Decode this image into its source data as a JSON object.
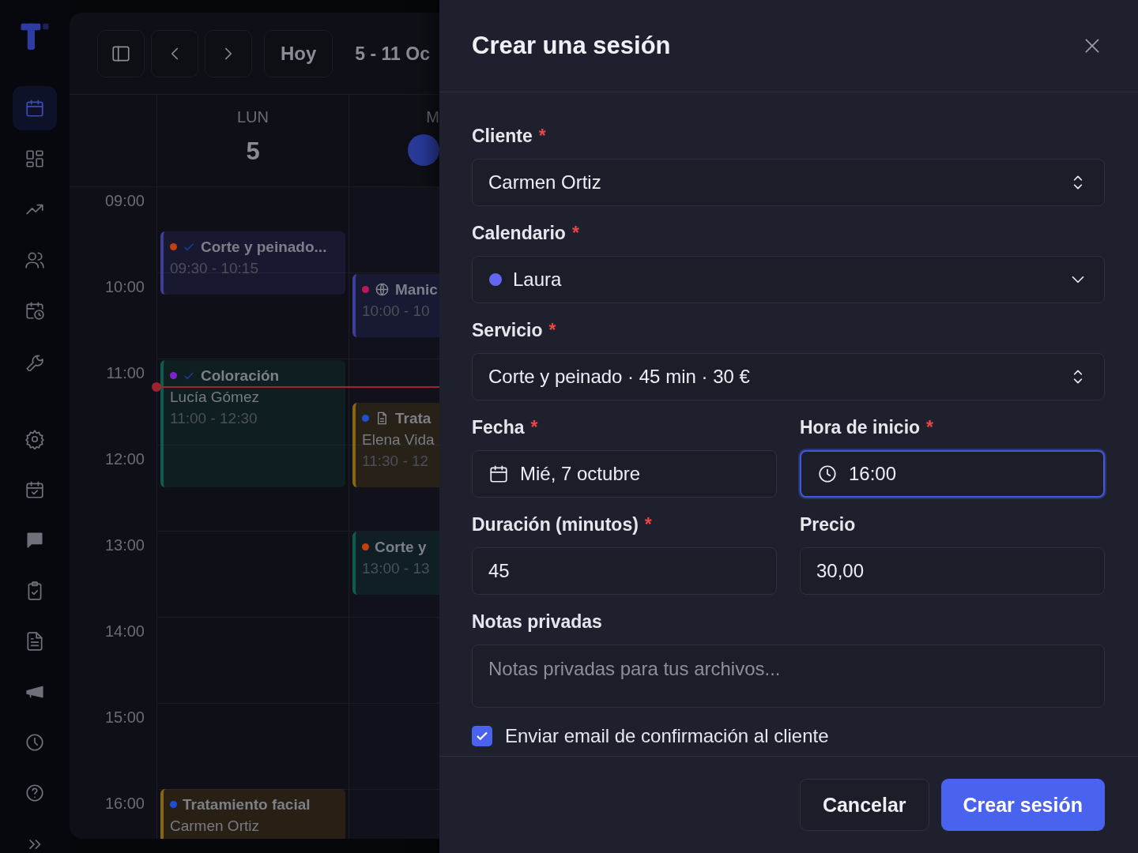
{
  "sidebar": {
    "items": [
      {
        "selected": true
      },
      {
        "selected": false
      },
      {
        "selected": false
      },
      {
        "selected": false
      },
      {
        "selected": false
      },
      {
        "selected": false
      },
      {
        "selected": false
      },
      {
        "selected": false
      },
      {
        "selected": false
      },
      {
        "selected": false
      },
      {
        "selected": false
      },
      {
        "selected": false
      },
      {
        "selected": false
      },
      {
        "selected": false
      }
    ]
  },
  "toolbar": {
    "today_button": "Hoy",
    "date_range": "5 - 11 Oc"
  },
  "time_labels": [
    "09:00",
    "10:00",
    "11:00",
    "12:00",
    "13:00",
    "14:00",
    "15:00",
    "16:00"
  ],
  "now_indicator": true,
  "days": [
    {
      "weekday": "LUN",
      "date": "5",
      "today": false,
      "events": [
        {
          "kind": "plain",
          "title": "Corte y peinado...",
          "time": "09:30 - 10:15",
          "confirmed": true,
          "color": "#c2410c",
          "border": {
            "color": "#3b3f9a"
          }
        },
        {
          "kind": "plain",
          "title": "Coloración",
          "client": "Lucía Gómez",
          "time": "11:00 - 12:30",
          "confirmed": true,
          "color": "#7e22ce",
          "border": {
            "color": "#0f5b4c"
          }
        },
        {
          "kind": "plain",
          "title": "Tratamiento facial",
          "client": "Carmen Ortiz",
          "confirmed": false,
          "color": "#1d4ed8",
          "border": {
            "color": "#8a6410"
          }
        }
      ]
    },
    {
      "weekday": "M",
      "today": true,
      "events": [
        {
          "kind": "online",
          "title": "Manic",
          "time": "10:00 - 10",
          "confirmed": false,
          "color": "#be185d",
          "border": {
            "color": "#3b3f9a"
          }
        },
        {
          "kind": "notes",
          "title": "Trata",
          "client": "Elena Vida",
          "time": "11:30 - 12",
          "confirmed": false,
          "color": "#1d4ed8",
          "border": {
            "color": "#8a6410"
          }
        },
        {
          "kind": "plain",
          "title": "Corte y",
          "time": "13:00 - 13",
          "confirmed": false,
          "color": "#c2410c",
          "border": {
            "color": "#0f5b4c"
          }
        }
      ]
    }
  ],
  "drawer": {
    "title": "Crear una sesión",
    "fields": [
      {
        "kind": "updown",
        "full_width": true,
        "label": "Cliente",
        "mark": "*",
        "value": "Carmen Ortiz",
        "focused": false
      },
      {
        "kind": "dropdown",
        "full_width": true,
        "label": "Calendario",
        "mark": "*",
        "value": "Laura",
        "color": "#6366f1",
        "focused": false
      },
      {
        "kind": "updown",
        "full_width": true,
        "label": "Servicio",
        "mark": "*",
        "value": "Corte y peinado · 45 min · 30 €",
        "focused": false
      },
      {
        "kind": "date",
        "full_width": false,
        "label": "Fecha",
        "mark": "*",
        "value": "Mié, 7 octubre",
        "focused": false
      },
      {
        "kind": "time",
        "full_width": false,
        "label": "Hora de inicio",
        "mark": "*",
        "value": "16:00",
        "focused": true
      },
      {
        "kind": "text",
        "full_width": false,
        "label": "Duración (minutos)",
        "mark": "*",
        "value": "45",
        "focused": false
      },
      {
        "kind": "text",
        "full_width": false,
        "label": "Precio",
        "value": "30,00",
        "focused": false
      },
      {
        "kind": "textarea",
        "full_width": true,
        "label": "Notas privadas",
        "placeholder": "Notas privadas para tus archivos...",
        "focused": false
      }
    ],
    "send_email": {
      "label": "Enviar email de confirmación al cliente",
      "checked": true
    },
    "buttons": [
      {
        "kind": "secondary",
        "label": "Cancelar"
      },
      {
        "kind": "primary",
        "label": "Crear sesión"
      }
    ]
  }
}
